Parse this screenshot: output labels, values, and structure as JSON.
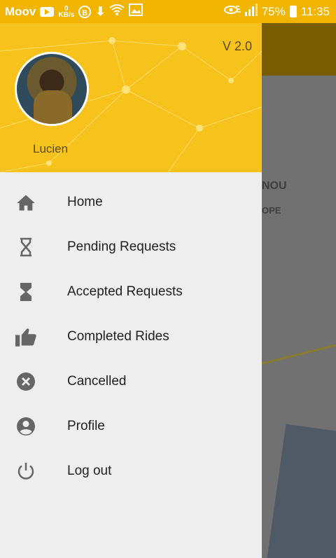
{
  "status_bar": {
    "carrier": "Moov",
    "speed_value": "0",
    "speed_unit": "KB/s",
    "bluetooth_letter": "B",
    "battery": "75%",
    "time": "11:35"
  },
  "drawer": {
    "version": "V 2.0",
    "username": "Lucien",
    "items": [
      {
        "label": "Home",
        "icon": "home-icon"
      },
      {
        "label": "Pending Requests",
        "icon": "hourglass-empty-icon"
      },
      {
        "label": "Accepted Requests",
        "icon": "hourglass-full-icon"
      },
      {
        "label": "Completed Rides",
        "icon": "thumb-up-icon"
      },
      {
        "label": "Cancelled",
        "icon": "cancel-icon"
      },
      {
        "label": "Profile",
        "icon": "account-circle-icon"
      },
      {
        "label": "Log out",
        "icon": "power-icon"
      }
    ]
  },
  "map": {
    "label_1": "NOU",
    "label_2": "OPE"
  },
  "colors": {
    "status_bar": "#f1b400",
    "header": "#f7c21c",
    "drawer_bg": "#eeeeee",
    "icon": "#666666"
  }
}
